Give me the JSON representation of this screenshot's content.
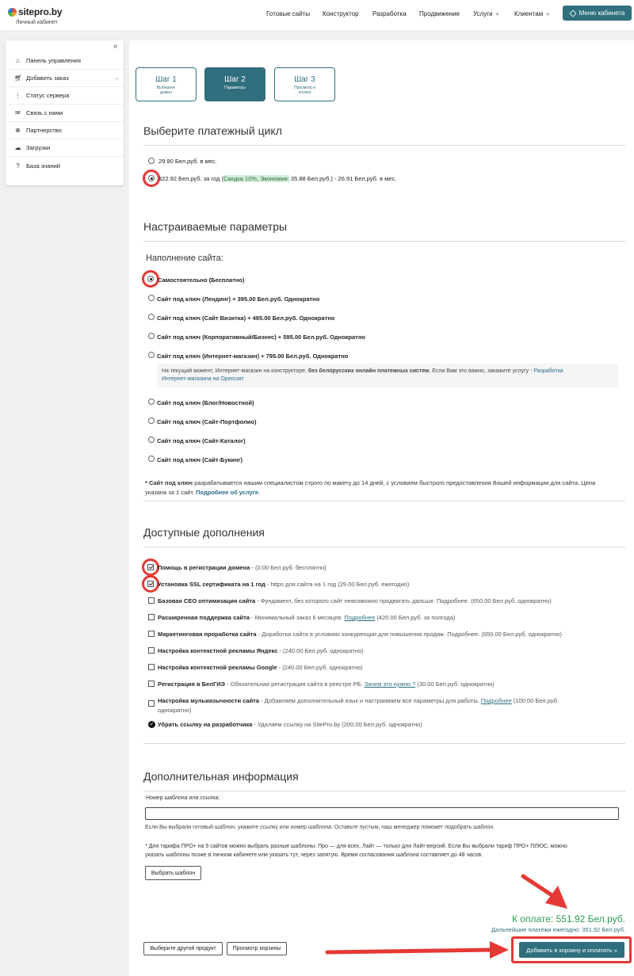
{
  "header": {
    "logo_text": "sitepro.by",
    "logo_subtitle": "Личный кабинет",
    "nav": [
      "Готовые сайты",
      "Конструктор",
      "Разработка",
      "Продвижение",
      "Услуги",
      "Клиентам"
    ],
    "menu_button": "Меню кабинета"
  },
  "sidebar": {
    "collapse_glyph": "«",
    "items": [
      {
        "label": "Панель управления",
        "icon": "home-icon"
      },
      {
        "label": "Добавить заказ",
        "icon": "cart-icon"
      },
      {
        "label": "Статус сервера",
        "icon": "signal-icon"
      },
      {
        "label": "Связь с нами",
        "icon": "envelope-icon"
      },
      {
        "label": "Партнерство",
        "icon": "handshake-icon"
      },
      {
        "label": "Загрузки",
        "icon": "cloud-download-icon"
      },
      {
        "label": "База знаний",
        "icon": "question-icon"
      }
    ]
  },
  "steps": [
    {
      "title": "Шаг 1",
      "sub": "Выберите домен"
    },
    {
      "title": "Шаг 2",
      "sub": "Параметры"
    },
    {
      "title": "Шаг 3",
      "sub": "Просмотр и оплата"
    }
  ],
  "billing": {
    "title": "Выберите платежный цикл",
    "opt1": "29.90 Бел.руб. в мес.",
    "opt2_pre": "322.92 Бел.руб. за год (",
    "opt2_discount": "Скидка 10%, Экономия:",
    "opt2_post": " 35.88 Бел.руб.) - 26.91 Бел.руб. в мес."
  },
  "config": {
    "title": "Настраиваемые параметры",
    "subtitle": "Наполнение сайта:",
    "options": [
      "Самостоятельно (Бесплатно)",
      "Сайт под ключ (Лендинг) + 395.00 Бел.руб. Однократно",
      "Сайт под ключ (Сайт Визитка) + 495.00 Бел.руб. Однократно",
      "Сайт под ключ (Корпоративный/Бизнес) + 595.00 Бел.руб. Однократно",
      "Сайт под ключ (Интернет-магазин) + 795.00 Бел.руб. Однократно",
      "Сайт под ключ (Блог/Новостной)",
      "Сайт под ключ (Сайт-Портфолио)",
      "Сайт под ключ (Сайт-Каталог)",
      "Сайт под ключ (Сайт-Букинг)"
    ],
    "note_pre": "На текущий момент, Интернет-магазин на конструкторе, ",
    "note_bold": "без белорусских онлайн платежных систем",
    "note_mid": ". Если Вам это важно, закажите услугу - ",
    "note_link1": "Разработка",
    "note_link2": "Интернет-магазина на Opencart",
    "footnote_bold": "* Сайт под ключ",
    "footnote_text": " разрабатывается нашим специалистом строго по макету до 14 дней, с условием быстрого предоставления Вашей информации для сайта. Цена",
    "footnote_text2": "указана за 1 сайт. ",
    "footnote_link": "Подробнее об услуге",
    "footnote_end": "."
  },
  "addons": {
    "title": "Доступные дополнения",
    "items": [
      {
        "name": "Помощь в регистрации домена",
        "desc": " - (0.00 Бел.руб. бесплатно)",
        "link": "",
        "after": ""
      },
      {
        "name": "Установка SSL сертификата на 1 год",
        "desc": " - https для сайта на 1 год (29.00 Бел.руб. ежегодно)",
        "link": "",
        "after": ""
      },
      {
        "name": "Базовая СЕО оптимизация сайта",
        "desc": " - Фундамент, без которого сайт невозможно продвигать дальше. Подробнее. (650.00 Бел.руб. однократно)",
        "link": "",
        "after": ""
      },
      {
        "name": "Расширенная поддержка сайта",
        "desc": " - Минимальный заказ 6 месяцев. ",
        "link": "Подробнее",
        "after": " (420.00 Бел.руб. за полгода)"
      },
      {
        "name": "Маркетинговая проработка сайта",
        "desc": " - Доработка сайта в условиях конкуренции для повышения продаж. Подробнее. (650.00 Бел.руб. однократно)",
        "link": "",
        "after": ""
      },
      {
        "name": "Настройка контекстной рекламы Яндекс",
        "desc": " - (240.00 Бел.руб. однократно)",
        "link": "",
        "after": ""
      },
      {
        "name": "Настройка контекстной рекламы Google",
        "desc": " - (240.00 Бел.руб. однократно)",
        "link": "",
        "after": ""
      },
      {
        "name": "Регистрация в БелГИЭ",
        "desc": " - Обязательная регистрация сайта в реестре РБ. ",
        "link": "Зачем это нужно ?",
        "after": " (30.00 Бел.руб. однократно)"
      },
      {
        "name": "Настройка мульиязычности сайта",
        "desc": " - Добавляем дополнительный язык и настраиваем все параметры для работы. ",
        "link": "Подробнее",
        "after": " (100.00 Бел.руб.",
        "line2": "однократно)"
      },
      {
        "name": "Убрать ссылку на разработчика",
        "desc": " - Удаляем ссылку на SitePro.by (200.00 Бел.руб. однократно)",
        "link": "",
        "after": ""
      }
    ]
  },
  "extra": {
    "title": "Дополнительная информация",
    "field_label": "Номер шаблона или ссылка:",
    "field_value": "",
    "help": "Если Вы выбрали готовый шаблон, укажите ссылку или номер шаблона. Оставьте пустым, наш менеджер поможет подобрать шаблон.",
    "tariff_note1": "* Для тарифа ПРО+ на 5 сайтов можно выбрать разные шаблоны: Про — для всех, Лайт — только для Лайт-версий. Если Вы выбрали тариф ПРО+ ПЛЮС, можно",
    "tariff_note2": "указать шаблоны позже в личном кабинете или указать тут, через запятую. Время согласования шаблона составляет до 48 часов.",
    "choose_template": "Выбрать шаблон"
  },
  "footer": {
    "total": "К оплате: 551.92 Бел.руб.",
    "recurring": "Дальнейшие платежи ежегодно: 351.92 Бел.руб.",
    "other_product": "Выберите другой продукт",
    "view_cart": "Просмотр корзины",
    "add_to_cart": "Добавить в корзину и оплатить »"
  },
  "colors": {
    "accent": "#2f6f7e",
    "highlight_red": "#e53935",
    "total_green": "#2e9c50"
  }
}
